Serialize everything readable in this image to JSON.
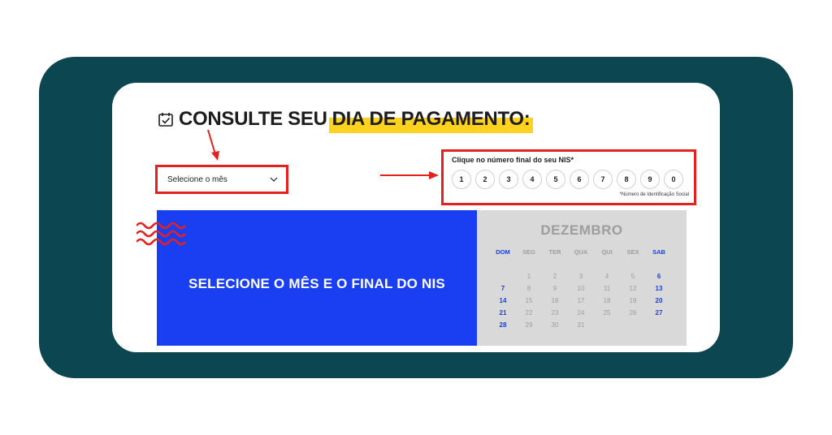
{
  "title": {
    "part1": "CONSULTE SEU",
    "part2": "DIA DE PAGAMENTO:"
  },
  "month_select": {
    "label": "Selecione o mês"
  },
  "nis": {
    "label": "Clique no número final do seu NIS*",
    "digits": [
      "1",
      "2",
      "3",
      "4",
      "5",
      "6",
      "7",
      "8",
      "9",
      "0"
    ],
    "footnote": "*Número de Identificação Social"
  },
  "banner": {
    "text": "SELECIONE O MÊS E O FINAL DO NIS"
  },
  "calendar": {
    "month": "DEZEMBRO",
    "weekdays": [
      "DOM",
      "SEG",
      "TER",
      "QUA",
      "QUI",
      "SEX",
      "SAB"
    ],
    "weeks": [
      [
        "",
        "1",
        "2",
        "3",
        "4",
        "5",
        "6"
      ],
      [
        "7",
        "8",
        "9",
        "10",
        "11",
        "12",
        "13"
      ],
      [
        "14",
        "15",
        "16",
        "17",
        "18",
        "19",
        "20"
      ],
      [
        "21",
        "22",
        "23",
        "24",
        "25",
        "26",
        "27"
      ],
      [
        "28",
        "29",
        "30",
        "31",
        "",
        "",
        ""
      ]
    ]
  },
  "colors": {
    "frame": "#0c4650",
    "highlight": "#ffd21f",
    "annotation_red": "#e3211e",
    "banner_blue": "#1a3ff2",
    "weekend_blue": "#1d3fd6"
  },
  "icons": {
    "title_icon": "calendar-check-icon",
    "select_icon": "chevron-down-icon"
  }
}
